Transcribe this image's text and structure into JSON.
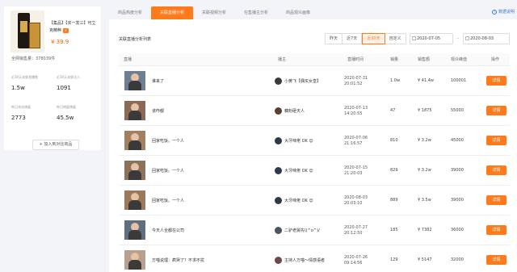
{
  "product": {
    "title": "【集品】【买一发三】可立克精粹",
    "price": "¥ 39.9",
    "total_sales_label": "全网销售量：",
    "total_sales_value": "378039件",
    "stats": [
      {
        "label": "近30天关联直播数",
        "value": "1.5w"
      },
      {
        "label": "近30天关联达人",
        "value": "1091"
      },
      {
        "label": "昨日浏览增量",
        "value": "2773"
      },
      {
        "label": "昨日销量增量",
        "value": "45.5w"
      }
    ],
    "compare_label": "+ 加入到对比商品"
  },
  "tabs": [
    {
      "label": "商品热度分析"
    },
    {
      "label": "关联直播分析"
    },
    {
      "label": "关联视频分析"
    },
    {
      "label": "在售播主分析"
    },
    {
      "label": "商品观众画像"
    }
  ],
  "help_label": "数据说明",
  "panel_title": "关联直播分析列表",
  "range_buttons": [
    "昨天",
    "近7天",
    "近30天",
    "自定义"
  ],
  "date_start": "2020-07-05",
  "date_sep": "-",
  "date_end": "2020-08-03",
  "table": {
    "headers": [
      "直播",
      "播主",
      "直播时间",
      "销量",
      "销售额",
      "观众峰值",
      "操作"
    ],
    "rows": [
      {
        "title": "谁来了",
        "anchor": "小黄飞【偶买女皇】",
        "time": "2020-07-31 20:01:52",
        "sales": "1.0w",
        "revenue": "¥ 41.4w",
        "peak": "100001",
        "action": "详情"
      },
      {
        "title": "该咋都",
        "anchor": "藕粉砸天人",
        "time": "2020-07-13 14:20:55",
        "sales": "47",
        "revenue": "¥ 1875",
        "peak": "55000",
        "action": "详情"
      },
      {
        "title": "回家吃饭。一个人",
        "anchor": "大牙味佬 OK 😊",
        "time": "2020-07-06 21:16:57",
        "sales": "810",
        "revenue": "¥ 3.2w",
        "peak": "45000",
        "action": "详情"
      },
      {
        "title": "回家吃饭。一个人",
        "anchor": "大牙味佬 OK 😊",
        "time": "2020-07-15 21:20:03",
        "sales": "829",
        "revenue": "¥ 3.2w",
        "peak": "39000",
        "action": "详情"
      },
      {
        "title": "回家吃饭。一个人",
        "anchor": "大牙味佬 OK 😊",
        "time": "2020-08-03 20:03:10",
        "sales": "889",
        "revenue": "¥ 3.5w",
        "peak": "39000",
        "action": "详情"
      },
      {
        "title": "今天人全都在公司",
        "anchor": "二驴老舅先\\(^o^)/",
        "time": "2020-07-27 20:12:50",
        "sales": "185",
        "revenue": "¥ 7382",
        "peak": "36000",
        "action": "详情"
      },
      {
        "title": "方喵说理：疯哭了？不求不扰",
        "anchor": "主持人方喵～情感语者",
        "time": "2020-07-26 09:14:56",
        "sales": "129",
        "revenue": "¥ 5147",
        "peak": "32000",
        "action": "详情"
      }
    ]
  },
  "colors": {
    "accent": "#ff7a1a",
    "price": "#ff5b00",
    "link": "#3a7bd5"
  }
}
